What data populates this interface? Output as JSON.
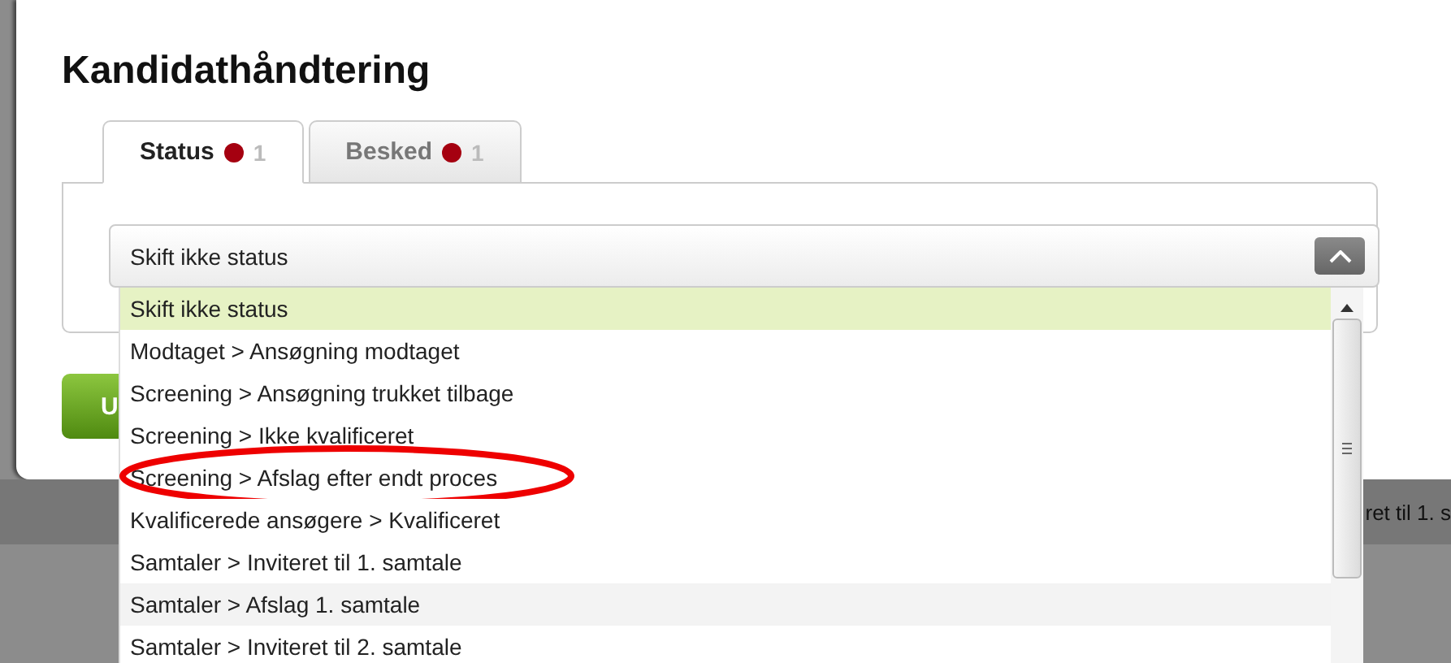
{
  "dialog": {
    "title": "Kandidathåndtering",
    "tabs": [
      {
        "label": "Status",
        "count": "1",
        "selected": true
      },
      {
        "label": "Besked",
        "count": "1",
        "selected": false
      }
    ],
    "status_select": {
      "value": "Skift ikke status",
      "expanded": true
    },
    "options": [
      {
        "label": "Skift ikke status",
        "selected": true,
        "hovered": false,
        "circled": false
      },
      {
        "label": "Modtaget > Ansøgning modtaget",
        "selected": false,
        "hovered": false,
        "circled": false
      },
      {
        "label": "Screening > Ansøgning trukket tilbage",
        "selected": false,
        "hovered": false,
        "circled": false
      },
      {
        "label": "Screening > Ikke kvalificeret",
        "selected": false,
        "hovered": false,
        "circled": false
      },
      {
        "label": "Screening > Afslag efter endt proces",
        "selected": false,
        "hovered": false,
        "circled": true
      },
      {
        "label": "Kvalificerede ansøgere > Kvalificeret",
        "selected": false,
        "hovered": false,
        "circled": false
      },
      {
        "label": "Samtaler > Inviteret til 1. samtale",
        "selected": false,
        "hovered": false,
        "circled": false
      },
      {
        "label": "Samtaler > Afslag 1. samtale",
        "selected": false,
        "hovered": true,
        "circled": false
      },
      {
        "label": "Samtaler > Inviteret til 2. samtale",
        "selected": false,
        "hovered": false,
        "circled": false
      }
    ],
    "button": {
      "label": "U"
    }
  },
  "background": {
    "row_text": "ret til 1. s"
  }
}
